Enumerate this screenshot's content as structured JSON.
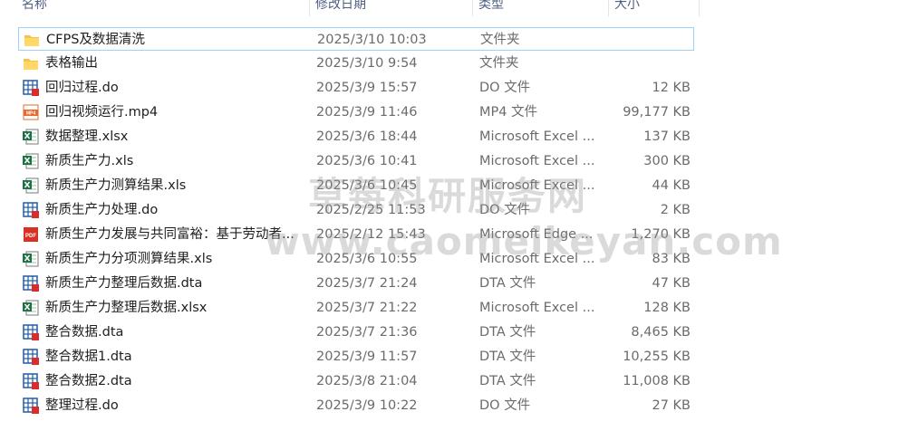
{
  "columns": {
    "name": "名称",
    "date": "修改日期",
    "type": "类型",
    "size": "大小"
  },
  "files": [
    {
      "name": "CFPS及数据清洗",
      "date": "2025/3/10 10:03",
      "type": "文件夹",
      "size": "",
      "icon": "folder-icon",
      "selected": true
    },
    {
      "name": "表格输出",
      "date": "2025/3/10 9:54",
      "type": "文件夹",
      "size": "",
      "icon": "folder-icon",
      "selected": false
    },
    {
      "name": "回归过程.do",
      "date": "2025/3/9 15:57",
      "type": "DO 文件",
      "size": "12 KB",
      "icon": "stata-file-icon",
      "selected": false
    },
    {
      "name": "回归视频运行.mp4",
      "date": "2025/3/9 11:46",
      "type": "MP4 文件",
      "size": "99,177 KB",
      "icon": "mp4-file-icon",
      "selected": false
    },
    {
      "name": "数据整理.xlsx",
      "date": "2025/3/6 18:44",
      "type": "Microsoft Excel ...",
      "size": "137 KB",
      "icon": "excel-file-icon",
      "selected": false
    },
    {
      "name": "新质生产力.xls",
      "date": "2025/3/6 10:41",
      "type": "Microsoft Excel ...",
      "size": "300 KB",
      "icon": "excel-file-icon",
      "selected": false
    },
    {
      "name": "新质生产力测算结果.xls",
      "date": "2025/3/6 10:45",
      "type": "Microsoft Excel ...",
      "size": "44 KB",
      "icon": "excel-file-icon",
      "selected": false
    },
    {
      "name": "新质生产力处理.do",
      "date": "2025/2/25 11:53",
      "type": "DO 文件",
      "size": "2 KB",
      "icon": "stata-file-icon",
      "selected": false
    },
    {
      "name": "新质生产力发展与共同富裕：基于劳动者...",
      "date": "2025/2/12 15:43",
      "type": "Microsoft Edge ...",
      "size": "1,270 KB",
      "icon": "pdf-file-icon",
      "selected": false
    },
    {
      "name": "新质生产力分项测算结果.xls",
      "date": "2025/3/6 10:55",
      "type": "Microsoft Excel ...",
      "size": "83 KB",
      "icon": "excel-file-icon",
      "selected": false
    },
    {
      "name": "新质生产力整理后数据.dta",
      "date": "2025/3/7 21:24",
      "type": "DTA 文件",
      "size": "47 KB",
      "icon": "stata-file-icon",
      "selected": false
    },
    {
      "name": "新质生产力整理后数据.xlsx",
      "date": "2025/3/7 21:22",
      "type": "Microsoft Excel ...",
      "size": "128 KB",
      "icon": "excel-file-icon",
      "selected": false
    },
    {
      "name": "整合数据.dta",
      "date": "2025/3/7 21:36",
      "type": "DTA 文件",
      "size": "8,465 KB",
      "icon": "stata-file-icon",
      "selected": false
    },
    {
      "name": "整合数据1.dta",
      "date": "2025/3/9 11:57",
      "type": "DTA 文件",
      "size": "10,255 KB",
      "icon": "stata-file-icon",
      "selected": false
    },
    {
      "name": "整合数据2.dta",
      "date": "2025/3/8 21:04",
      "type": "DTA 文件",
      "size": "11,008 KB",
      "icon": "stata-file-icon",
      "selected": false
    },
    {
      "name": "整理过程.do",
      "date": "2025/3/9 10:22",
      "type": "DO 文件",
      "size": "27 KB",
      "icon": "stata-file-icon",
      "selected": false
    }
  ],
  "watermark": {
    "text_cn": "草莓科研服务网",
    "text_url": "www.caomeikeyan.com"
  },
  "colors": {
    "folder": "#f4c24d",
    "stata_blue": "#1f5ba8",
    "stata_red": "#d92c2c",
    "excel_green": "#1e7145",
    "pdf_red": "#d93025",
    "mp4_orange": "#e8692e",
    "selection_border": "#99d1ff"
  }
}
